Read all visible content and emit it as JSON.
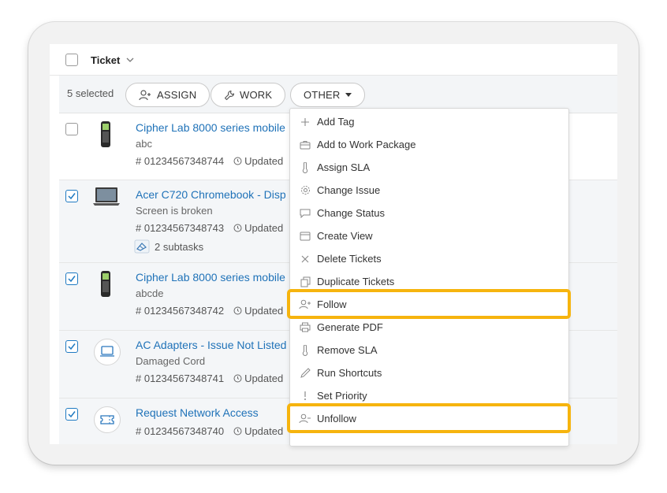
{
  "header": {
    "title": "Ticket"
  },
  "selection": {
    "count_text": "5 selected",
    "assign_label": "ASSIGN",
    "work_label": "WORK",
    "other_label": "OTHER"
  },
  "tickets": [
    {
      "title": "Cipher Lab 8000 series mobile",
      "subtitle": "abc",
      "number": "# 01234567348744",
      "updated": "Updated",
      "checked": false
    },
    {
      "title": "Acer C720 Chromebook - Disp",
      "subtitle": "Screen is broken",
      "number": "# 01234567348743",
      "updated": "Updated",
      "subtasks": "2 subtasks",
      "checked": true
    },
    {
      "title": "Cipher Lab 8000 series mobile",
      "subtitle": "abcde",
      "number": "# 01234567348742",
      "updated": "Updated",
      "checked": true
    },
    {
      "title": "AC Adapters - Issue Not Listed",
      "subtitle": "Damaged Cord",
      "number": "# 01234567348741",
      "updated": "Updated",
      "checked": true
    },
    {
      "title": "Request Network Access",
      "number": "# 01234567348740",
      "updated": "Updated",
      "checked": true
    }
  ],
  "menu": {
    "items": [
      {
        "label": "Add Tag",
        "icon": "plus-icon"
      },
      {
        "label": "Add to Work Package",
        "icon": "briefcase-icon"
      },
      {
        "label": "Assign SLA",
        "icon": "thermometer-icon"
      },
      {
        "label": "Change Issue",
        "icon": "gear-icon"
      },
      {
        "label": "Change Status",
        "icon": "flag-icon"
      },
      {
        "label": "Create View",
        "icon": "window-icon"
      },
      {
        "label": "Delete Tickets",
        "icon": "close-icon"
      },
      {
        "label": "Duplicate Tickets",
        "icon": "copy-icon"
      },
      {
        "label": "Follow",
        "icon": "user-plus-icon",
        "highlighted": true
      },
      {
        "label": "Generate PDF",
        "icon": "printer-icon"
      },
      {
        "label": "Remove SLA",
        "icon": "thermometer-icon"
      },
      {
        "label": "Run Shortcuts",
        "icon": "pencil-icon"
      },
      {
        "label": "Set Priority",
        "icon": "exclamation-icon"
      },
      {
        "label": "Unfollow",
        "icon": "user-minus-icon",
        "highlighted": true
      }
    ]
  },
  "colors": {
    "link": "#1f72b8",
    "highlight": "#f6b40e",
    "checkbox_checked": "#1f7ac2"
  }
}
